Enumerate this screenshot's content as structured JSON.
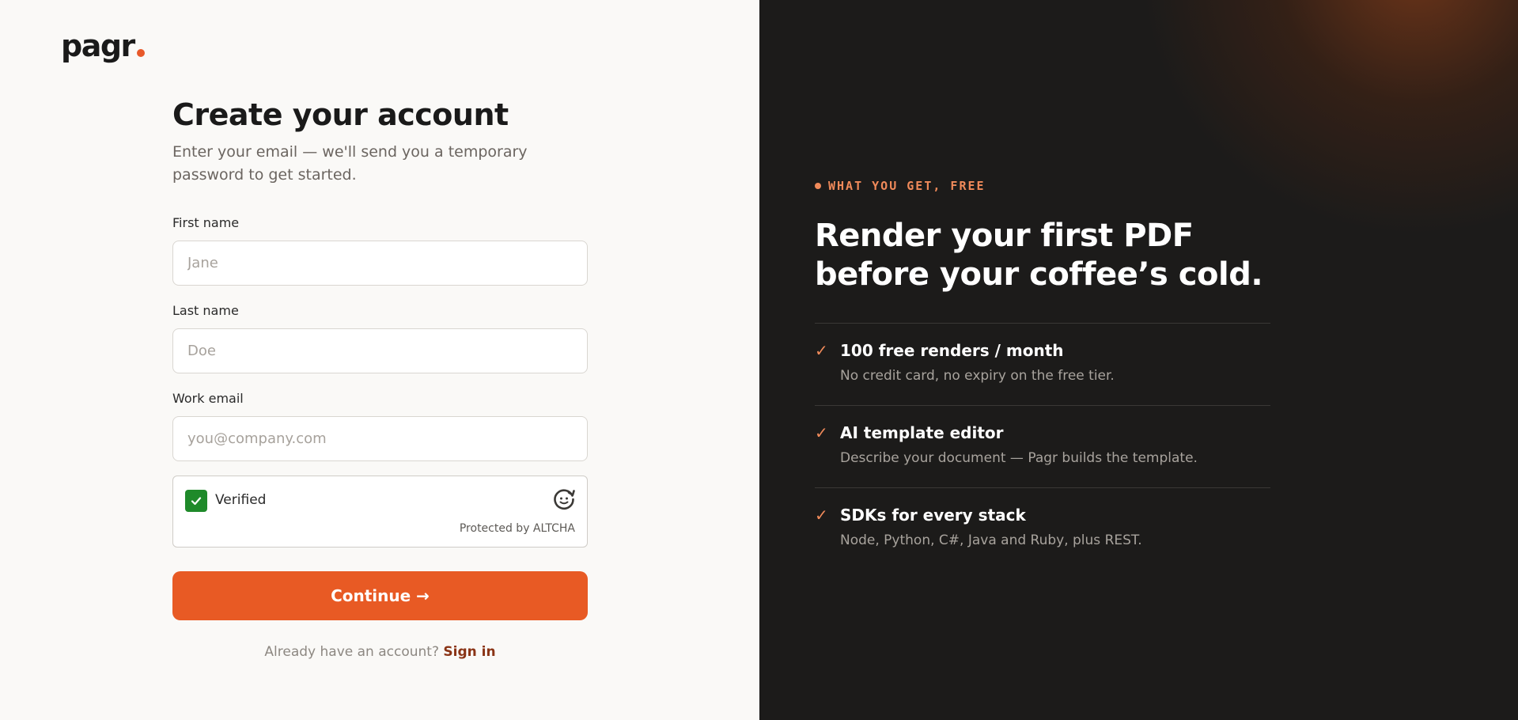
{
  "brand": {
    "logo_text": "pagr",
    "accent_color": "#e85a24"
  },
  "signup": {
    "title": "Create your account",
    "subtitle": "Enter your email — we'll send you a temporary password to get started.",
    "fields": {
      "first_name": {
        "label": "First name",
        "placeholder": "Jane",
        "value": ""
      },
      "last_name": {
        "label": "Last name",
        "placeholder": "Doe",
        "value": ""
      },
      "work_email": {
        "label": "Work email",
        "placeholder": "you@company.com",
        "value": ""
      }
    },
    "captcha": {
      "status": "Verified",
      "checked": true,
      "footer": "Protected by ALTCHA",
      "icon": "altcha-logo-icon"
    },
    "continue_label": "Continue →",
    "signin_prompt": "Already have an account?",
    "signin_link": "Sign in"
  },
  "promo": {
    "eyebrow": "WHAT YOU GET, FREE",
    "headline": "Render your first PDF before your coffee’s cold.",
    "features": [
      {
        "icon": "check-icon",
        "title": "100 free renders / month",
        "description": "No credit card, no expiry on the free tier."
      },
      {
        "icon": "check-icon",
        "title": "AI template editor",
        "description": "Describe your document — Pagr builds the template."
      },
      {
        "icon": "check-icon",
        "title": "SDKs for every stack",
        "description": "Node, Python, C#, Java and Ruby, plus REST."
      }
    ]
  },
  "colors": {
    "left_background": "#faf9f7",
    "right_background": "#1c1b1a",
    "eyebrow": "#f08a5a",
    "verified_green": "#1f8a2a",
    "signin_link": "#8a3416"
  }
}
